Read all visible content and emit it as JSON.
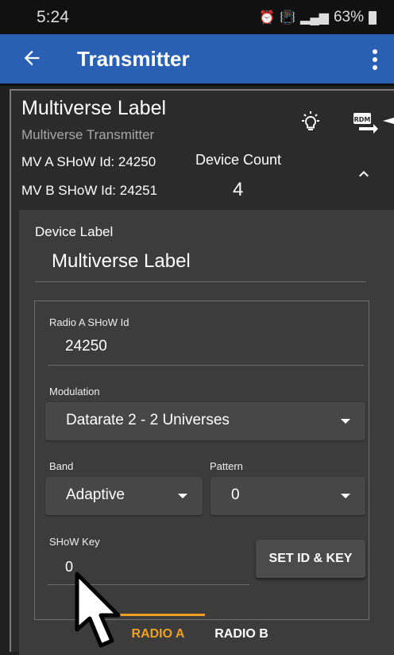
{
  "status_bar": {
    "time": "5:24",
    "battery": "63%"
  },
  "app_bar": {
    "back_icon": "arrow-left-icon",
    "title": "Transmitter",
    "menu_icon": "more-vert-icon"
  },
  "header": {
    "label": "Multiverse Label",
    "subtitle": "Multiverse Transmitter",
    "mv_a": "MV A SHoW Id: 24250",
    "mv_b": "MV B SHoW Id: 24251",
    "device_count_label": "Device Count",
    "device_count": "4",
    "icons": [
      "lightbulb-icon",
      "rdm-icon",
      "chevron-up-icon"
    ]
  },
  "device": {
    "label_title": "Device Label",
    "label_value": "Multiverse Label"
  },
  "radio": {
    "show_id_label": "Radio A SHoW Id",
    "show_id_value": "24250",
    "modulation_label": "Modulation",
    "modulation_value": "Datarate 2 - 2 Universes",
    "band_label": "Band",
    "band_value": "Adaptive",
    "pattern_label": "Pattern",
    "pattern_value": "0",
    "key_label": "SHoW Key",
    "key_value": "0",
    "set_button": "SET ID & KEY"
  },
  "tabs": [
    {
      "label": "RADIO A",
      "active": true
    },
    {
      "label": "RADIO B",
      "active": false
    }
  ],
  "colors": {
    "app_bar": "#2a60b3",
    "accent": "#f0a020",
    "background": "#202020"
  }
}
